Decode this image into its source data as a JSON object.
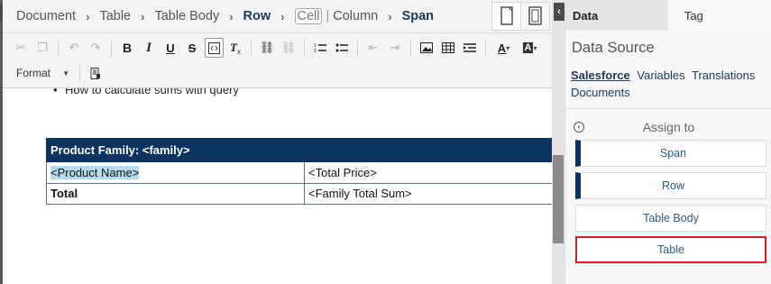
{
  "breadcrumb": {
    "items": [
      "Document",
      "Table",
      "Table Body",
      "Row",
      "Cell",
      "Column",
      "Span"
    ]
  },
  "toolbar": {
    "format_label": "Format"
  },
  "document": {
    "bullet_text": "How to calculate sums with query",
    "table": {
      "header": "Product Family: <family>",
      "rows": [
        [
          "<Product Name>",
          "<Total Price>"
        ],
        [
          "Total",
          "<Family Total Sum>"
        ]
      ]
    }
  },
  "panel": {
    "tabs": [
      "Data",
      "Tag"
    ],
    "data_source_title": "Data Source",
    "sources": [
      "Salesforce",
      "Variables",
      "Translations",
      "Documents"
    ],
    "assign_label": "Assign to",
    "assign_buttons": [
      "Span",
      "Row",
      "Table Body",
      "Table"
    ]
  },
  "colors": {
    "accent_navy": "#0b3460",
    "highlight": "#b6dbef",
    "selected_border": "#d32029",
    "link_blue": "#2b5a86"
  }
}
